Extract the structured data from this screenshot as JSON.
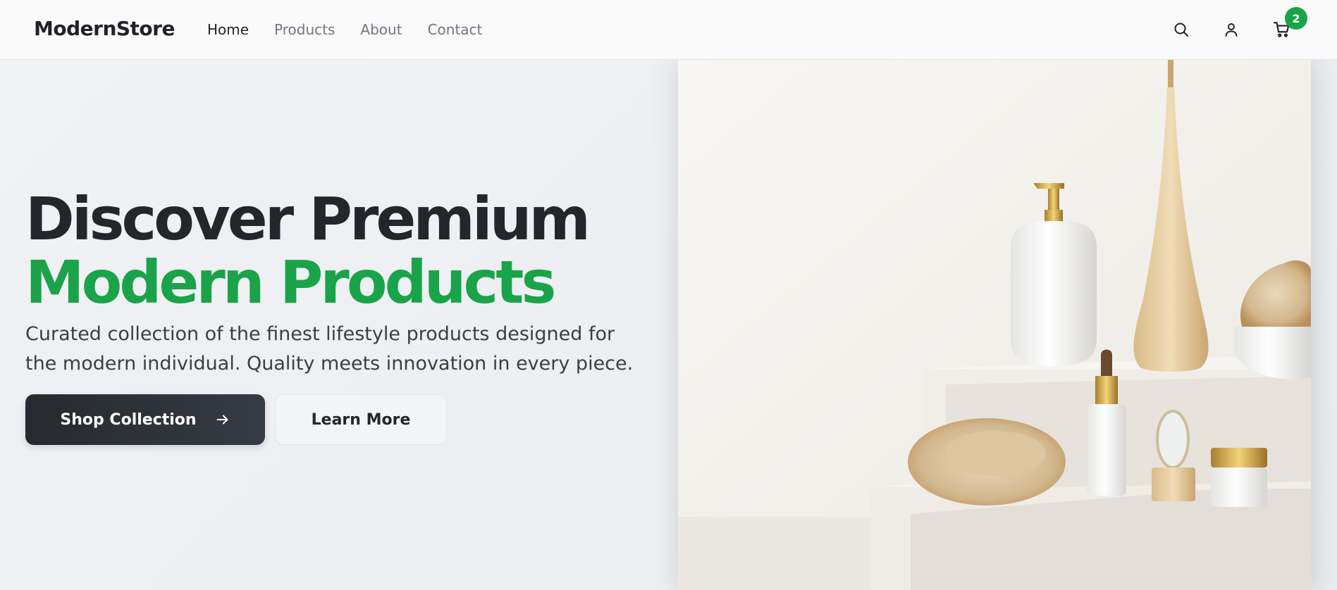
{
  "header": {
    "logo": "ModernStore",
    "nav": [
      {
        "label": "Home",
        "active": true
      },
      {
        "label": "Products",
        "active": false
      },
      {
        "label": "About",
        "active": false
      },
      {
        "label": "Contact",
        "active": false
      }
    ],
    "icons": {
      "search": "search-icon",
      "account": "user-icon",
      "cart": "cart-icon"
    },
    "cart_count": "2"
  },
  "hero": {
    "title_line1": "Discover Premium",
    "title_line2": "Modern Products",
    "subtitle": "Curated collection of the finest lifestyle products designed for the modern individual. Quality meets innovation in every piece.",
    "primary_button": "Shop Collection",
    "secondary_button": "Learn More"
  },
  "colors": {
    "accent": "#1ba34a",
    "dark": "#23262b",
    "muted_nav": "#707680"
  }
}
